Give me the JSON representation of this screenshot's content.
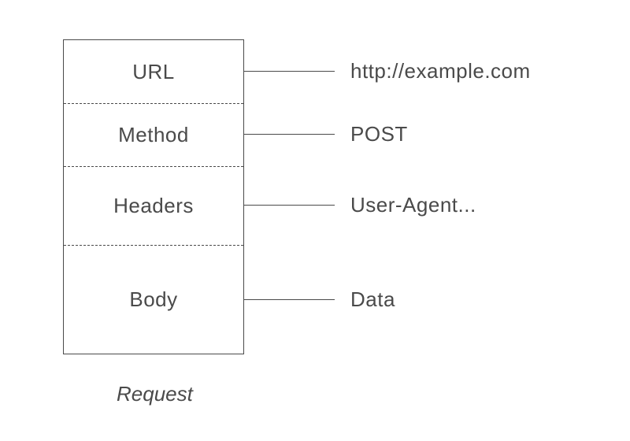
{
  "diagram": {
    "title": "Request",
    "rows": [
      {
        "label": "URL",
        "value": "http://example.com"
      },
      {
        "label": "Method",
        "value": "POST"
      },
      {
        "label": "Headers",
        "value": "User-Agent..."
      },
      {
        "label": "Body",
        "value": "Data"
      }
    ]
  }
}
